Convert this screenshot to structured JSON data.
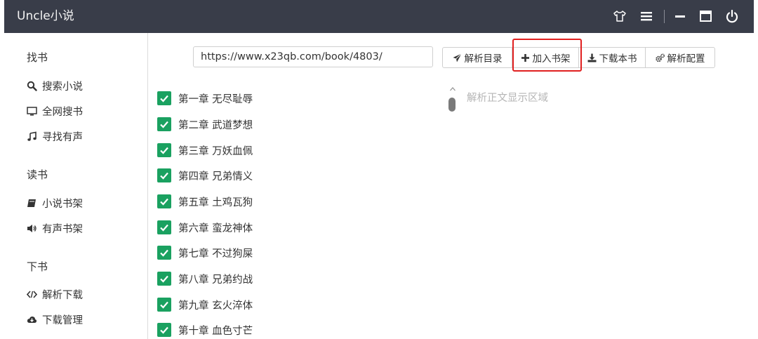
{
  "titlebar": {
    "title": "Uncle小说",
    "icons": [
      "tshirt-icon",
      "menu-icon",
      "minimize-icon",
      "maximize-icon",
      "power-icon"
    ]
  },
  "sidebar": {
    "groups": [
      {
        "label": "找书",
        "items": [
          {
            "label": "搜索小说",
            "icon": "search-icon"
          },
          {
            "label": "全网搜书",
            "icon": "monitor-icon"
          },
          {
            "label": "寻找有声",
            "icon": "music-icon"
          }
        ]
      },
      {
        "label": "读书",
        "items": [
          {
            "label": "小说书架",
            "icon": "book-icon"
          },
          {
            "label": "有声书架",
            "icon": "volume-icon"
          }
        ]
      },
      {
        "label": "下书",
        "items": [
          {
            "label": "解析下载",
            "icon": "code-icon"
          },
          {
            "label": "下载管理",
            "icon": "cloud-download-icon"
          }
        ]
      }
    ]
  },
  "toolbar": {
    "url_value": "https://www.x23qb.com/book/4803/",
    "buttons": [
      {
        "label": "解析目录",
        "icon": "send-icon"
      },
      {
        "label": "加入书架",
        "icon": "plus-icon"
      },
      {
        "label": "下载本书",
        "icon": "download-icon"
      },
      {
        "label": "解析配置",
        "icon": "gears-icon"
      }
    ],
    "highlight_color": "#e02020"
  },
  "chapters": [
    {
      "label": "第一章 无尽耻辱",
      "checked": true
    },
    {
      "label": "第二章 武道梦想",
      "checked": true
    },
    {
      "label": "第三章 万妖血佩",
      "checked": true
    },
    {
      "label": "第四章 兄弟情义",
      "checked": true
    },
    {
      "label": "第五章 土鸡瓦狗",
      "checked": true
    },
    {
      "label": "第六章 蛮龙神体",
      "checked": true
    },
    {
      "label": "第七章 不过狗屎",
      "checked": true
    },
    {
      "label": "第八章 兄弟约战",
      "checked": true
    },
    {
      "label": "第九章 玄火淬体",
      "checked": true
    },
    {
      "label": "第十章 血色寸芒",
      "checked": true
    }
  ],
  "content": {
    "placeholder": "解析正文显示区域"
  },
  "colors": {
    "titlebar_bg": "#393d49",
    "checkbox_green": "#1aa160",
    "sidebar_accent": "#2e9c4b"
  }
}
